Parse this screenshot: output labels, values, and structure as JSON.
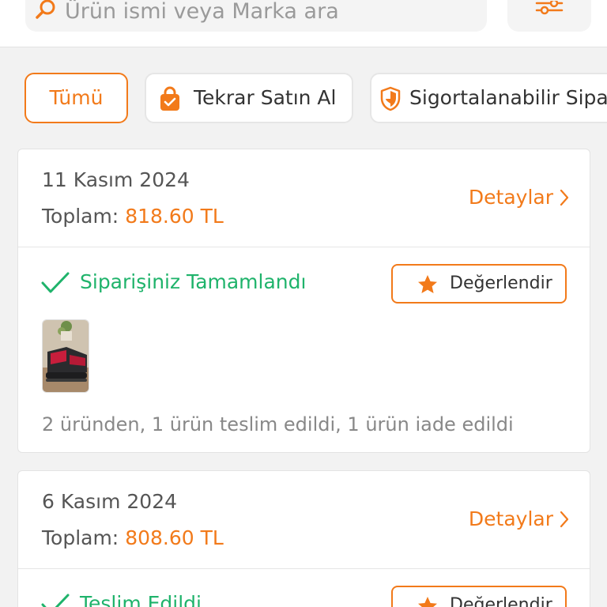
{
  "search": {
    "placeholder": "Ürün ismi veya Marka ara",
    "icon": "search-icon"
  },
  "filter": {
    "icon": "filter-sliders-icon"
  },
  "filters": {
    "all": "Tümü",
    "rebuy": "Tekrar Satın Al",
    "insured": "Sigortalanabilir Sipar"
  },
  "colors": {
    "accent": "#f27a1a",
    "success": "#1fb36b"
  },
  "orders": [
    {
      "date": "11 Kasım 2024",
      "total_label": "Toplam:",
      "total": "818.60 TL",
      "details": "Detaylar",
      "status": "Siparişiniz Tamamlandı",
      "rate": "Değerlendir",
      "summary": "2 üründen, 1 ürün teslim edildi, 1 ürün iade edildi"
    },
    {
      "date": "6 Kasım 2024",
      "total_label": "Toplam:",
      "total": "808.60 TL",
      "details": "Detaylar",
      "status": "Teslim Edildi",
      "rate": "Değerlendir"
    }
  ]
}
